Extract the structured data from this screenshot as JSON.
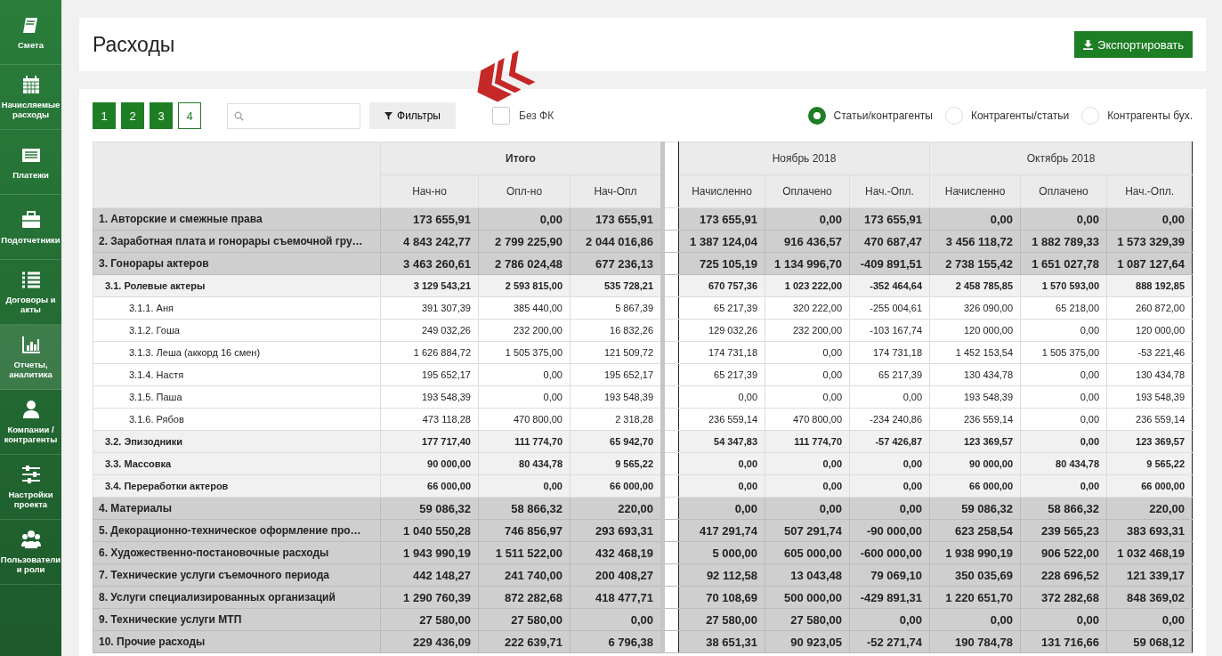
{
  "sidebar": {
    "items": [
      {
        "label": "Смета",
        "selected": false
      },
      {
        "label": "Начисляемые расходы",
        "selected": false
      },
      {
        "label": "Платежи",
        "selected": false
      },
      {
        "label": "Подотчетники",
        "selected": false
      },
      {
        "label": "Договоры и акты",
        "selected": false
      },
      {
        "label": "Отчеты, аналитика",
        "selected": true
      },
      {
        "label": "Компании / контрагенты",
        "selected": false
      },
      {
        "label": "Настройки проекта",
        "selected": false
      },
      {
        "label": "Пользователи и роли",
        "selected": false
      }
    ]
  },
  "header": {
    "title": "Расходы",
    "export_button": "Экспортировать"
  },
  "toolbar": {
    "pages": [
      {
        "label": "1",
        "selected": false
      },
      {
        "label": "2",
        "selected": false
      },
      {
        "label": "3",
        "selected": false
      },
      {
        "label": "4",
        "selected": true
      }
    ],
    "filter_button": "Фильтры",
    "checkbox": {
      "label": "Без ФК",
      "checked": false
    },
    "radios": [
      {
        "label": "Статьи/контрагенты",
        "selected": true
      },
      {
        "label": "Контрагенты/статьи",
        "selected": false
      },
      {
        "label": "Контрагенты бух.",
        "selected": false
      }
    ]
  },
  "table": {
    "groups": [
      {
        "label": "Итого",
        "columns": [
          "Нач-но",
          "Опл-но",
          "Нач-Опл"
        ]
      },
      {
        "label": "Ноябрь 2018",
        "columns": [
          "Начисленно",
          "Оплачено",
          "Нач.-Опл."
        ]
      },
      {
        "label": "Октябрь 2018",
        "columns": [
          "Начисленно",
          "Оплачено",
          "Нач.-Опл."
        ]
      }
    ],
    "rows": [
      {
        "label": "1. Авторские и смежные права",
        "values": [
          "173 655,91",
          "0,00",
          "173 655,91",
          "173 655,91",
          "0,00",
          "173 655,91",
          "0,00",
          "0,00",
          "0,00"
        ]
      },
      {
        "label": "2. Заработная плата и гонорары съемочной гру…",
        "values": [
          "4 843 242,77",
          "2 799 225,90",
          "2 044 016,86",
          "1 387 124,04",
          "916 436,57",
          "470 687,47",
          "3 456 118,72",
          "1 882 789,33",
          "1 573 329,39"
        ]
      },
      {
        "label": "3. Гонорары актеров",
        "values": [
          "3 463 260,61",
          "2 786 024,48",
          "677 236,13",
          "725 105,19",
          "1 134 996,70",
          "-409 891,51",
          "2 738 155,42",
          "1 651 027,78",
          "1 087 127,64"
        ],
        "children": [
          {
            "label": "3.1. Ролевые актеры",
            "values": [
              "3 129 543,21",
              "2 593 815,00",
              "535 728,21",
              "670 757,36",
              "1 023 222,00",
              "-352 464,64",
              "2 458 785,85",
              "1 570 593,00",
              "888 192,85"
            ],
            "children": [
              {
                "label": "3.1.1. Аня",
                "values": [
                  "391 307,39",
                  "385 440,00",
                  "5 867,39",
                  "65 217,39",
                  "320 222,00",
                  "-255 004,61",
                  "326 090,00",
                  "65 218,00",
                  "260 872,00"
                ]
              },
              {
                "label": "3.1.2. Гоша",
                "values": [
                  "249 032,26",
                  "232 200,00",
                  "16 832,26",
                  "129 032,26",
                  "232 200,00",
                  "-103 167,74",
                  "120 000,00",
                  "0,00",
                  "120 000,00"
                ]
              },
              {
                "label": "3.1.3. Леша (аккорд 16 смен)",
                "values": [
                  "1 626 884,72",
                  "1 505 375,00",
                  "121 509,72",
                  "174 731,18",
                  "0,00",
                  "174 731,18",
                  "1 452 153,54",
                  "1 505 375,00",
                  "-53 221,46"
                ]
              },
              {
                "label": "3.1.4. Настя",
                "values": [
                  "195 652,17",
                  "0,00",
                  "195 652,17",
                  "65 217,39",
                  "0,00",
                  "65 217,39",
                  "130 434,78",
                  "0,00",
                  "130 434,78"
                ]
              },
              {
                "label": "3.1.5. Паша",
                "values": [
                  "193 548,39",
                  "0,00",
                  "193 548,39",
                  "0,00",
                  "0,00",
                  "0,00",
                  "193 548,39",
                  "0,00",
                  "193 548,39"
                ]
              },
              {
                "label": "3.1.6. Рябов",
                "values": [
                  "473 118,28",
                  "470 800,00",
                  "2 318,28",
                  "236 559,14",
                  "470 800,00",
                  "-234 240,86",
                  "236 559,14",
                  "0,00",
                  "236 559,14"
                ]
              }
            ]
          },
          {
            "label": "3.2. Эпизодники",
            "values": [
              "177 717,40",
              "111 774,70",
              "65 942,70",
              "54 347,83",
              "111 774,70",
              "-57 426,87",
              "123 369,57",
              "0,00",
              "123 369,57"
            ]
          },
          {
            "label": "3.3. Массовка",
            "values": [
              "90 000,00",
              "80 434,78",
              "9 565,22",
              "0,00",
              "0,00",
              "0,00",
              "90 000,00",
              "80 434,78",
              "9 565,22"
            ]
          },
          {
            "label": "3.4. Переработки актеров",
            "values": [
              "66 000,00",
              "0,00",
              "66 000,00",
              "0,00",
              "0,00",
              "0,00",
              "66 000,00",
              "0,00",
              "66 000,00"
            ]
          }
        ]
      },
      {
        "label": "4. Материалы",
        "values": [
          "59 086,32",
          "58 866,32",
          "220,00",
          "0,00",
          "0,00",
          "0,00",
          "59 086,32",
          "58 866,32",
          "220,00"
        ]
      },
      {
        "label": "5. Декорационно-техническое оформление про…",
        "values": [
          "1 040 550,28",
          "746 856,97",
          "293 693,31",
          "417 291,74",
          "507 291,74",
          "-90 000,00",
          "623 258,54",
          "239 565,23",
          "383 693,31"
        ]
      },
      {
        "label": "6. Художественно-постановочные расходы",
        "values": [
          "1 943 990,19",
          "1 511 522,00",
          "432 468,19",
          "5 000,00",
          "605 000,00",
          "-600 000,00",
          "1 938 990,19",
          "906 522,00",
          "1 032 468,19"
        ]
      },
      {
        "label": "7. Технические услуги съемочного периода",
        "values": [
          "442 148,27",
          "241 740,00",
          "200 408,27",
          "92 112,58",
          "13 043,48",
          "79 069,10",
          "350 035,69",
          "228 696,52",
          "121 339,17"
        ]
      },
      {
        "label": "8. Услуги специализированных организаций",
        "values": [
          "1 290 760,39",
          "872 282,68",
          "418 477,71",
          "70 108,69",
          "500 000,00",
          "-429 891,31",
          "1 220 651,70",
          "372 282,68",
          "848 369,02"
        ]
      },
      {
        "label": "9. Технические услуги МТП",
        "values": [
          "27 580,00",
          "27 580,00",
          "0,00",
          "27 580,00",
          "27 580,00",
          "0,00",
          "0,00",
          "0,00",
          "0,00"
        ]
      },
      {
        "label": "10. Прочие расходы",
        "values": [
          "229 436,09",
          "222 639,71",
          "6 796,38",
          "38 651,31",
          "90 923,05",
          "-52 271,74",
          "190 784,78",
          "131 716,66",
          "59 068,12"
        ]
      }
    ]
  }
}
